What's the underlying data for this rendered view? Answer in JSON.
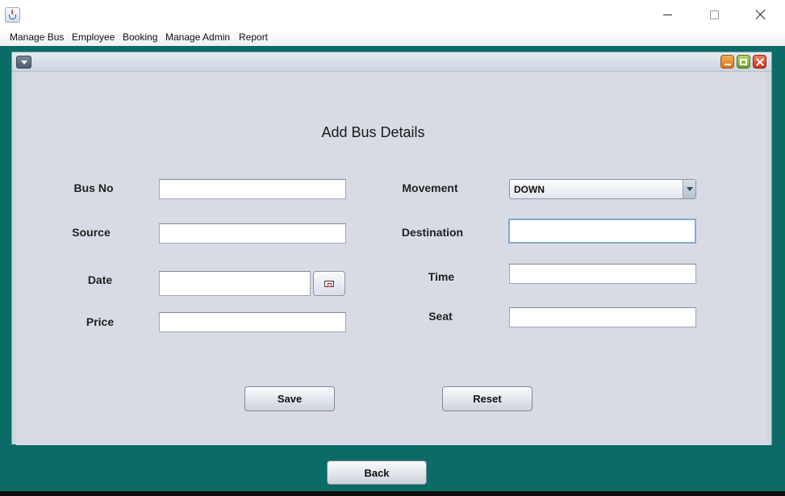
{
  "menubar": {
    "items": [
      "Manage Bus",
      "Employee",
      "Booking",
      "Manage Admin",
      "Report"
    ]
  },
  "form": {
    "title": "Add Bus Details",
    "fields": {
      "bus_no": {
        "label": "Bus No",
        "value": ""
      },
      "source": {
        "label": "Source",
        "value": ""
      },
      "date": {
        "label": "Date",
        "value": ""
      },
      "price": {
        "label": "Price",
        "value": ""
      },
      "movement": {
        "label": "Movement",
        "value": "DOWN"
      },
      "destination": {
        "label": "Destination",
        "value": ""
      },
      "time": {
        "label": "Time",
        "value": ""
      },
      "seat": {
        "label": "Seat",
        "value": ""
      }
    },
    "save_label": "Save",
    "reset_label": "Reset"
  },
  "footer": {
    "back_label": "Back"
  },
  "colors": {
    "desktop_accent": "#0b6b66",
    "form_background": "#d8dbe3"
  },
  "icons": {
    "app": "java-cup-icon",
    "date_picker": "calendar-icon"
  }
}
